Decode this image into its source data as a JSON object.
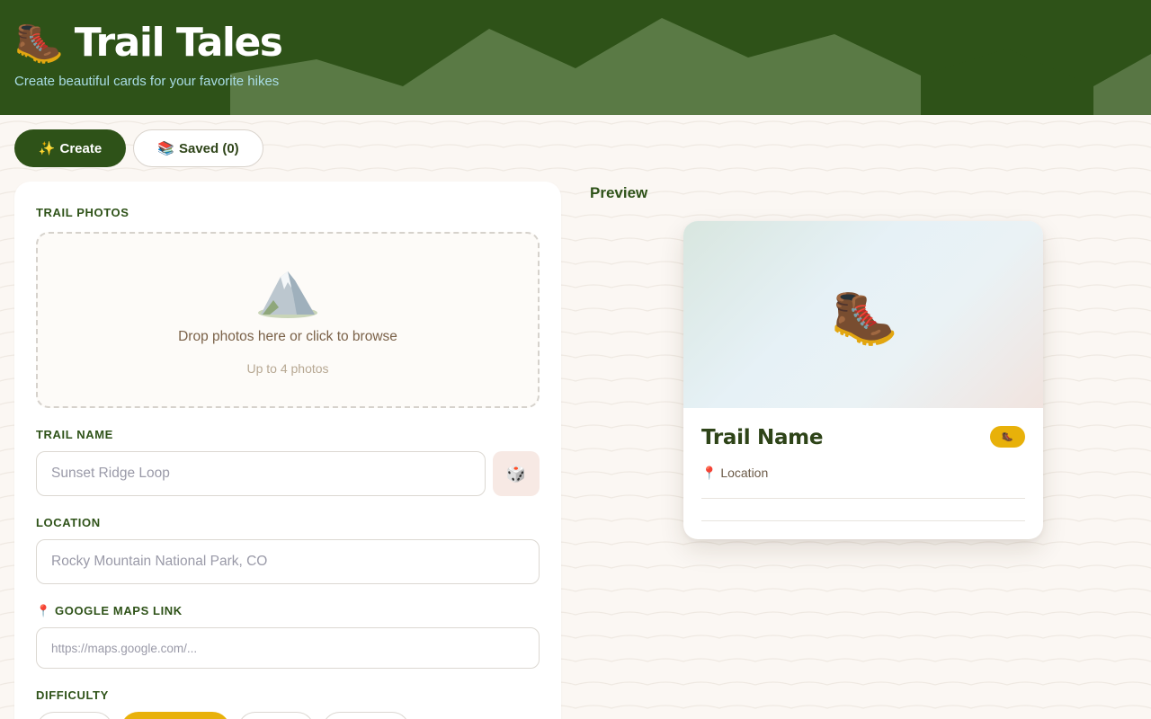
{
  "header": {
    "title": "Trail Tales",
    "tagline": "Create beautiful cards for your favorite hikes",
    "logo_icon": "hiking-boot-icon",
    "background_color": "#2e5218"
  },
  "tabs": [
    {
      "icon": "✨",
      "label": "Create",
      "active": true
    },
    {
      "icon": "📚",
      "label": "Saved (0)",
      "active": false
    }
  ],
  "form": {
    "photos": {
      "label": "TRAIL PHOTOS",
      "drop_text": "Drop photos here or click to browse",
      "sub_text": "Up to 4 photos",
      "icon": "mountain-icon"
    },
    "trail_name": {
      "label": "TRAIL NAME",
      "value": "",
      "placeholder": "Sunset Ridge Loop",
      "random_button_icon": "dice-icon"
    },
    "location": {
      "label": "LOCATION",
      "value": "",
      "placeholder": "Rocky Mountain National Park, CO"
    },
    "maps_link": {
      "icon": "📍",
      "label": "GOOGLE MAPS LINK",
      "value": "",
      "placeholder": "https://maps.google.com/..."
    },
    "difficulty": {
      "label": "DIFFICULTY",
      "options": [
        "",
        "",
        "",
        ""
      ],
      "selected_index": 1,
      "accent_color": "#e8b10a"
    }
  },
  "preview": {
    "label": "Preview",
    "card": {
      "title": "Trail Name",
      "location_icon": "📍",
      "location": "Location",
      "badge_icon": "hiking-boot-icon",
      "placeholder_icon": "hiking-boot-icon"
    }
  }
}
